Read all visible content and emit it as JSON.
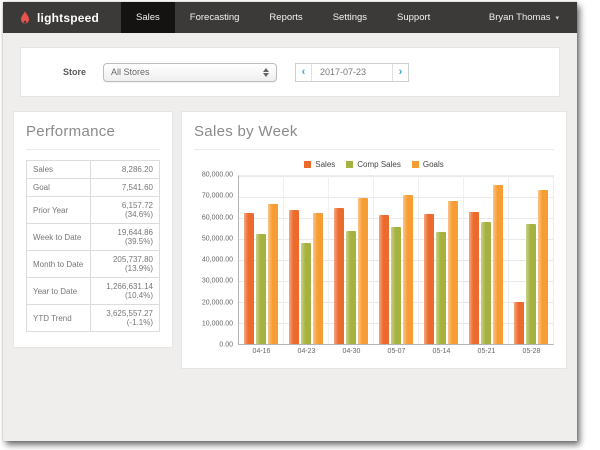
{
  "nav": {
    "brand": "lightspeed",
    "items": [
      {
        "label": "Sales",
        "active": true
      },
      {
        "label": "Forecasting",
        "active": false
      },
      {
        "label": "Reports",
        "active": false
      },
      {
        "label": "Settings",
        "active": false
      },
      {
        "label": "Support",
        "active": false
      }
    ],
    "user": "Bryan Thomas",
    "caret": "▾"
  },
  "filters": {
    "store_label": "Store",
    "store_value": "All Stores",
    "date_prev": "‹",
    "date_value": "2017-07-23",
    "date_next": "›"
  },
  "performance": {
    "title": "Performance",
    "rows": [
      {
        "label": "Sales",
        "value": "8,286.20"
      },
      {
        "label": "Goal",
        "value": "7,541.60"
      },
      {
        "label": "Prior Year",
        "value": "6,157.72 (34.6%)"
      },
      {
        "label": "Week to Date",
        "value": "19,644.86 (39.5%)"
      },
      {
        "label": "Month to Date",
        "value": "205,737.80 (13.9%)"
      },
      {
        "label": "Year to Date",
        "value": "1,266,631.14 (10.4%)"
      },
      {
        "label": "YTD Trend",
        "value": "3,625,557.27 (-1.1%)"
      }
    ]
  },
  "chart_title": "Sales by Week",
  "chart_data": {
    "type": "bar",
    "title": "Sales by Week",
    "categories": [
      "04-16",
      "04-23",
      "04-30",
      "05-07",
      "05-14",
      "05-21",
      "05-28"
    ],
    "series": [
      {
        "name": "Sales",
        "color": "#ed6a2d",
        "values": [
          62500,
          64000,
          65000,
          61500,
          62000,
          63000,
          20000
        ]
      },
      {
        "name": "Comp Sales",
        "color": "#a6b23f",
        "values": [
          52500,
          48000,
          54000,
          55500,
          53500,
          58000,
          57000
        ]
      },
      {
        "name": "Goals",
        "color": "#f89d33",
        "values": [
          66500,
          62500,
          69500,
          71000,
          68000,
          75500,
          73500
        ]
      }
    ],
    "ylim": [
      0,
      80000
    ],
    "ytick_step": 10000,
    "ytick_labels": [
      "80,000.00",
      "70,000.00",
      "60,000.00",
      "50,000.00",
      "40,000.00",
      "30,000.00",
      "20,000.00",
      "10,000.00",
      "0.00"
    ],
    "grid": true,
    "legend_position": "top"
  },
  "colors": {
    "navbar": "#3b3a38",
    "nav_active": "#141311",
    "brand_flame": "#e8534e",
    "page_bg": "#efeeec",
    "accent_blue": "#3aa0d8"
  }
}
